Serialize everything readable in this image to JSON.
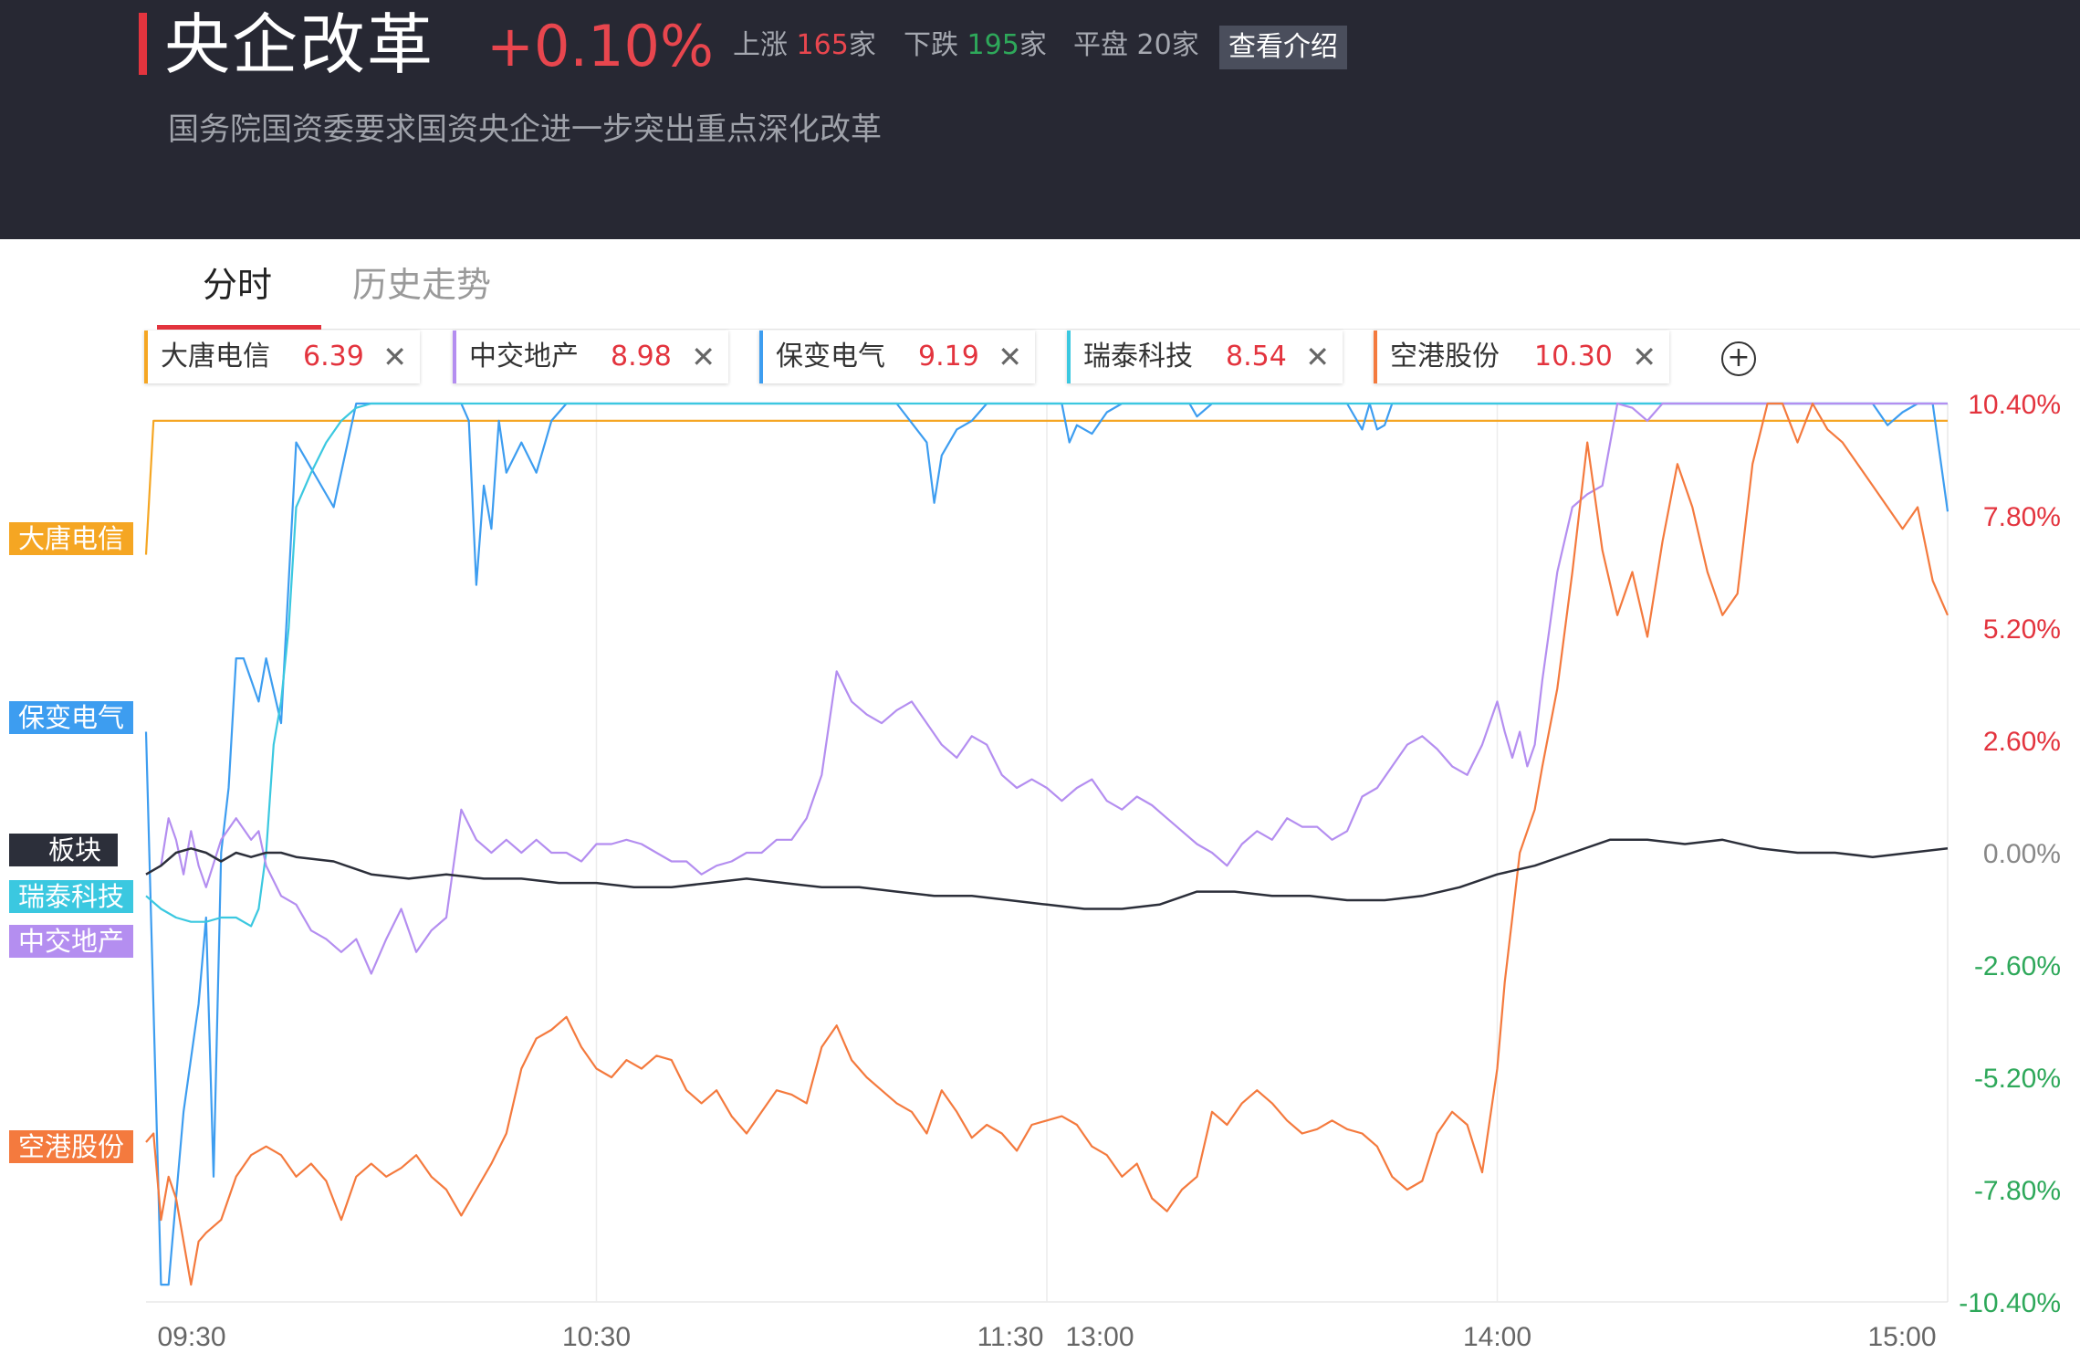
{
  "header": {
    "title": "央企改革",
    "change": "+0.10%",
    "up_label": "上涨",
    "up_count": "165",
    "down_label": "下跌",
    "down_count": "195",
    "flat_label": "平盘",
    "flat_count": "20",
    "unit": "家",
    "intro_button": "查看介绍",
    "subtitle": "国务院国资委要求国资央企进一步突出重点深化改革"
  },
  "tabs": [
    "分时",
    "历史走势"
  ],
  "chips": [
    {
      "name": "大唐电信",
      "value": "6.39",
      "color": "#f5a623"
    },
    {
      "name": "中交地产",
      "value": "8.98",
      "color": "#b48ef0"
    },
    {
      "name": "保变电气",
      "value": "9.19",
      "color": "#3d9df0"
    },
    {
      "name": "瑞泰科技",
      "value": "8.54",
      "color": "#3bc8e0"
    },
    {
      "name": "空港股份",
      "value": "10.30",
      "color": "#f47a3e"
    }
  ],
  "left_labels": [
    {
      "name": "大唐电信",
      "color": "#f5a623"
    },
    {
      "name": "保变电气",
      "color": "#3d9df0"
    },
    {
      "name": "板块",
      "color": "#2c2f3a"
    },
    {
      "name": "瑞泰科技",
      "color": "#3bc8e0"
    },
    {
      "name": "中交地产",
      "color": "#b48ef0"
    },
    {
      "name": "空港股份",
      "color": "#f47a3e"
    }
  ],
  "chart_data": {
    "type": "line",
    "ylim": [
      -10.4,
      10.4
    ],
    "y_ticks": [
      "10.40%",
      "7.80%",
      "5.20%",
      "2.60%",
      "0.00%",
      "-2.60%",
      "-5.20%",
      "-7.80%",
      "-10.40%"
    ],
    "x_ticks": [
      "09:30",
      "10:30",
      "11:30",
      "13:00",
      "14:00",
      "15:00"
    ],
    "x_minutes": [
      0,
      60,
      120,
      180,
      240
    ],
    "series": [
      {
        "name": "大唐电信",
        "color": "#f5a623",
        "x": [
          0,
          1,
          3,
          240
        ],
        "y": [
          6.9,
          10.0,
          10.0,
          10.0
        ]
      },
      {
        "name": "保变电气",
        "color": "#3d9df0",
        "x": [
          0,
          2,
          3,
          4,
          5,
          7,
          8,
          9,
          10,
          11,
          12,
          13,
          15,
          16,
          18,
          20,
          25,
          28,
          29,
          30,
          31,
          33,
          35,
          36,
          37,
          38,
          39,
          40,
          41,
          42,
          43,
          44,
          45,
          46,
          47,
          48,
          50,
          52,
          54,
          56,
          58,
          60,
          62,
          64,
          70,
          80,
          90,
          100,
          104,
          105,
          106,
          108,
          110,
          112,
          114,
          116,
          118,
          120,
          121,
          122,
          123,
          124,
          126,
          128,
          130,
          133,
          135,
          137,
          139,
          140,
          142,
          144,
          147,
          150,
          155,
          160,
          162,
          163,
          164,
          165,
          166,
          168,
          170,
          172,
          174,
          175,
          176,
          178,
          180,
          182,
          185,
          188,
          190,
          195,
          200,
          205,
          208,
          210,
          215,
          220,
          225,
          230,
          232,
          234,
          236,
          238,
          240
        ],
        "y": [
          2.8,
          -10.0,
          -10.0,
          -8.0,
          -6.0,
          -3.5,
          -1.5,
          -7.5,
          0.0,
          1.5,
          4.5,
          4.5,
          3.5,
          4.5,
          3.0,
          9.5,
          8.0,
          10.4,
          10.4,
          10.4,
          10.4,
          10.4,
          10.4,
          10.4,
          10.4,
          10.4,
          10.4,
          10.4,
          10.4,
          10.4,
          10.0,
          6.2,
          8.5,
          7.5,
          10.0,
          8.8,
          9.5,
          8.8,
          10.0,
          10.4,
          10.4,
          10.4,
          10.4,
          10.4,
          10.4,
          10.4,
          10.4,
          10.4,
          9.5,
          8.1,
          9.2,
          9.8,
          10.0,
          10.4,
          10.4,
          10.4,
          10.4,
          10.4,
          10.4,
          10.4,
          9.5,
          9.9,
          9.7,
          10.2,
          10.4,
          10.4,
          10.4,
          10.4,
          10.4,
          10.1,
          10.4,
          10.4,
          10.4,
          10.4,
          10.4,
          10.4,
          9.8,
          10.4,
          9.8,
          9.9,
          10.4,
          10.4,
          10.4,
          10.4,
          10.4,
          10.4,
          10.4,
          10.4,
          10.4,
          10.4,
          10.4,
          10.4,
          10.4,
          10.4,
          10.4,
          10.4,
          10.4,
          10.4,
          10.4,
          10.4,
          10.4,
          10.4,
          9.9,
          10.2,
          10.4,
          10.4,
          7.9
        ]
      },
      {
        "name": "瑞泰科技",
        "color": "#3bc8e0",
        "x": [
          0,
          2,
          4,
          6,
          8,
          10,
          12,
          14,
          15,
          16,
          17,
          18,
          19,
          20,
          22,
          24,
          26,
          28,
          30,
          240
        ],
        "y": [
          -1.0,
          -1.3,
          -1.5,
          -1.6,
          -1.6,
          -1.5,
          -1.5,
          -1.7,
          -1.3,
          0.0,
          2.5,
          3.5,
          5.2,
          8.0,
          8.8,
          9.5,
          10.0,
          10.3,
          10.4,
          10.4
        ]
      },
      {
        "name": "中交地产",
        "color": "#b48ef0",
        "x": [
          0,
          2,
          3,
          4,
          5,
          6,
          7,
          8,
          10,
          12,
          14,
          15,
          16,
          18,
          20,
          22,
          24,
          26,
          28,
          30,
          32,
          34,
          36,
          38,
          40,
          42,
          44,
          46,
          48,
          50,
          52,
          54,
          56,
          58,
          60,
          62,
          64,
          66,
          68,
          70,
          72,
          74,
          76,
          78,
          80,
          82,
          84,
          86,
          88,
          90,
          92,
          94,
          96,
          98,
          100,
          102,
          104,
          106,
          108,
          110,
          112,
          114,
          116,
          118,
          120,
          122,
          124,
          126,
          128,
          130,
          132,
          134,
          136,
          138,
          140,
          142,
          144,
          146,
          148,
          150,
          152,
          154,
          156,
          158,
          160,
          162,
          164,
          166,
          168,
          170,
          172,
          174,
          176,
          178,
          180,
          181,
          182,
          183,
          184,
          185,
          186,
          188,
          190,
          192,
          194,
          196,
          198,
          200,
          202,
          205,
          210,
          215,
          220,
          225,
          230,
          235,
          240
        ],
        "y": [
          -0.5,
          -0.3,
          0.8,
          0.3,
          -0.5,
          0.5,
          -0.3,
          -0.8,
          0.3,
          0.8,
          0.3,
          0.5,
          -0.3,
          -1.0,
          -1.2,
          -1.8,
          -2.0,
          -2.3,
          -2.0,
          -2.8,
          -2.0,
          -1.3,
          -2.3,
          -1.8,
          -1.5,
          1.0,
          0.3,
          0.0,
          0.3,
          0.0,
          0.3,
          0.0,
          0.0,
          -0.2,
          0.2,
          0.2,
          0.3,
          0.2,
          0.0,
          -0.2,
          -0.2,
          -0.5,
          -0.3,
          -0.2,
          0.0,
          0.0,
          0.3,
          0.3,
          0.8,
          1.8,
          4.2,
          3.5,
          3.2,
          3.0,
          3.3,
          3.5,
          3.0,
          2.5,
          2.2,
          2.7,
          2.5,
          1.8,
          1.5,
          1.7,
          1.5,
          1.2,
          1.5,
          1.7,
          1.2,
          1.0,
          1.3,
          1.1,
          0.8,
          0.5,
          0.2,
          0.0,
          -0.3,
          0.2,
          0.5,
          0.3,
          0.8,
          0.6,
          0.6,
          0.3,
          0.5,
          1.3,
          1.5,
          2.0,
          2.5,
          2.7,
          2.4,
          2.0,
          1.8,
          2.5,
          3.5,
          2.8,
          2.2,
          2.8,
          2.0,
          2.5,
          4.0,
          6.5,
          8.0,
          8.3,
          8.5,
          10.4,
          10.3,
          10.0,
          10.4,
          10.4,
          10.4,
          10.4,
          10.4,
          10.4,
          10.4,
          10.4,
          10.4
        ]
      },
      {
        "name": "空港股份",
        "color": "#f47a3e",
        "x": [
          0,
          1,
          2,
          3,
          4,
          5,
          6,
          7,
          8,
          10,
          12,
          14,
          16,
          18,
          20,
          22,
          24,
          26,
          28,
          30,
          32,
          34,
          36,
          38,
          40,
          42,
          44,
          46,
          48,
          50,
          52,
          54,
          56,
          58,
          60,
          62,
          64,
          66,
          68,
          70,
          72,
          74,
          76,
          78,
          80,
          82,
          84,
          86,
          88,
          90,
          92,
          94,
          96,
          98,
          100,
          102,
          104,
          106,
          108,
          110,
          112,
          114,
          116,
          118,
          120,
          122,
          124,
          126,
          128,
          130,
          132,
          134,
          136,
          138,
          140,
          142,
          144,
          146,
          148,
          150,
          152,
          154,
          156,
          158,
          160,
          162,
          164,
          166,
          168,
          170,
          172,
          174,
          176,
          178,
          180,
          181,
          182,
          183,
          184,
          185,
          186,
          188,
          190,
          192,
          194,
          196,
          198,
          200,
          202,
          204,
          206,
          208,
          210,
          212,
          214,
          216,
          218,
          220,
          222,
          224,
          226,
          228,
          230,
          232,
          234,
          236,
          238,
          240
        ],
        "y": [
          -6.7,
          -6.5,
          -8.5,
          -7.5,
          -8.0,
          -9.0,
          -10.0,
          -9.0,
          -8.8,
          -8.5,
          -7.5,
          -7.0,
          -6.8,
          -7.0,
          -7.5,
          -7.2,
          -7.6,
          -8.5,
          -7.5,
          -7.2,
          -7.5,
          -7.3,
          -7.0,
          -7.5,
          -7.8,
          -8.4,
          -7.8,
          -7.2,
          -6.5,
          -5.0,
          -4.3,
          -4.1,
          -3.8,
          -4.5,
          -5.0,
          -5.2,
          -4.8,
          -5.0,
          -4.7,
          -4.8,
          -5.5,
          -5.8,
          -5.5,
          -6.1,
          -6.5,
          -6.0,
          -5.5,
          -5.6,
          -5.8,
          -4.5,
          -4.0,
          -4.8,
          -5.2,
          -5.5,
          -5.8,
          -6.0,
          -6.5,
          -5.5,
          -6.0,
          -6.6,
          -6.3,
          -6.5,
          -6.9,
          -6.3,
          -6.2,
          -6.1,
          -6.3,
          -6.8,
          -7.0,
          -7.5,
          -7.2,
          -8.0,
          -8.3,
          -7.8,
          -7.5,
          -6.0,
          -6.3,
          -5.8,
          -5.5,
          -5.8,
          -6.2,
          -6.5,
          -6.4,
          -6.2,
          -6.4,
          -6.5,
          -6.8,
          -7.5,
          -7.8,
          -7.6,
          -6.5,
          -6.0,
          -6.3,
          -7.4,
          -5.0,
          -3.0,
          -1.5,
          0.0,
          0.5,
          1.0,
          2.0,
          3.8,
          6.5,
          9.5,
          7.0,
          5.5,
          6.5,
          5.0,
          7.2,
          9.0,
          8.0,
          6.5,
          5.5,
          6.0,
          9.0,
          10.4,
          10.4,
          9.5,
          10.4,
          9.8,
          9.5,
          9.0,
          8.5,
          8.0,
          7.5,
          8.0,
          6.3,
          5.5
        ]
      },
      {
        "name": "板块",
        "color": "#2c2f3a",
        "x": [
          0,
          2,
          4,
          6,
          8,
          10,
          12,
          14,
          16,
          18,
          20,
          25,
          30,
          35,
          40,
          45,
          50,
          55,
          60,
          65,
          70,
          75,
          80,
          85,
          90,
          95,
          100,
          105,
          110,
          115,
          120,
          125,
          130,
          135,
          140,
          145,
          150,
          155,
          160,
          165,
          170,
          175,
          180,
          185,
          190,
          195,
          200,
          205,
          210,
          215,
          220,
          225,
          230,
          235,
          240
        ],
        "y": [
          -0.5,
          -0.3,
          0.0,
          0.1,
          0.0,
          -0.2,
          0.0,
          -0.1,
          0.0,
          0.0,
          -0.1,
          -0.2,
          -0.5,
          -0.6,
          -0.5,
          -0.6,
          -0.6,
          -0.7,
          -0.7,
          -0.8,
          -0.8,
          -0.7,
          -0.6,
          -0.7,
          -0.8,
          -0.8,
          -0.9,
          -1.0,
          -1.0,
          -1.1,
          -1.2,
          -1.3,
          -1.3,
          -1.2,
          -0.9,
          -0.9,
          -1.0,
          -1.0,
          -1.1,
          -1.1,
          -1.0,
          -0.8,
          -0.5,
          -0.3,
          0.0,
          0.3,
          0.3,
          0.2,
          0.3,
          0.1,
          0.0,
          0.0,
          -0.1,
          0.0,
          0.1
        ]
      }
    ]
  }
}
